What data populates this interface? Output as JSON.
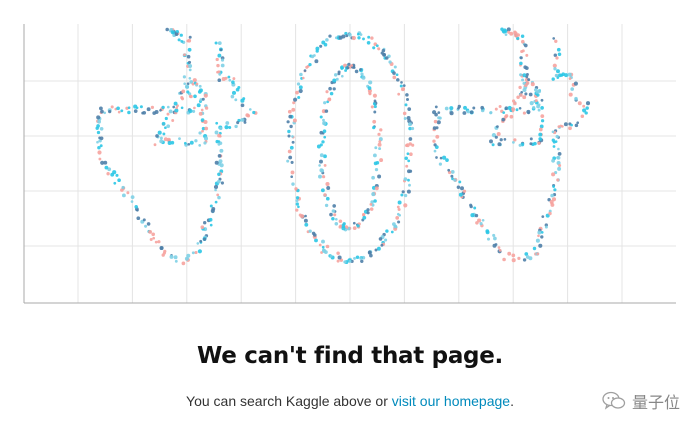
{
  "chart_data": {
    "type": "scatter",
    "title": "",
    "xlabel": "",
    "ylabel": "",
    "xlim": [
      0,
      60
    ],
    "ylim": [
      0,
      26
    ],
    "grid": true,
    "series_colors": [
      "#2bc6e6",
      "#f6a39e",
      "#4f7fa8",
      "#7ed0e6"
    ],
    "shape": "404",
    "glyphs": [
      {
        "char": "4",
        "outline": [
          [
            18,
            1.5
          ],
          [
            18,
            5
          ],
          [
            19.5,
            5
          ],
          [
            19.5,
            6.5
          ],
          [
            21,
            8
          ],
          [
            19.5,
            9.5
          ],
          [
            18,
            9.5
          ],
          [
            18,
            15
          ],
          [
            16,
            21.5
          ],
          [
            14.5,
            22
          ],
          [
            13,
            21.5
          ],
          [
            7,
            12
          ],
          [
            7,
            8
          ],
          [
            16,
            8
          ],
          [
            16,
            6.5
          ],
          [
            15,
            6.5
          ],
          [
            15,
            1.5
          ],
          [
            13,
            0.5
          ],
          [
            15,
            1.5
          ]
        ]
      },
      {
        "char": "0",
        "ellipse": {
          "cx": 30,
          "cy": 11.5,
          "rx": 5.5,
          "ry": 10.5,
          "inner_rx": 2.6,
          "inner_ry": 7.5
        }
      },
      {
        "char": "4",
        "outline": [
          [
            49,
            1.5
          ],
          [
            49,
            5
          ],
          [
            50.5,
            5
          ],
          [
            50.5,
            6.5
          ],
          [
            52,
            8
          ],
          [
            50.5,
            9.5
          ],
          [
            49,
            9.5
          ],
          [
            49,
            15
          ],
          [
            47,
            21.5
          ],
          [
            45.5,
            22
          ],
          [
            44,
            21.5
          ],
          [
            38,
            12
          ],
          [
            38,
            8
          ],
          [
            47,
            8
          ],
          [
            47,
            6.5
          ],
          [
            46,
            6.5
          ],
          [
            46,
            1.5
          ],
          [
            44,
            0.5
          ],
          [
            46,
            1.5
          ]
        ]
      }
    ]
  },
  "headline": "We can't find that page.",
  "subline": {
    "prefix": "You can search Kaggle above or ",
    "link_text": "visit our homepage",
    "suffix": "."
  },
  "watermark": {
    "text": "量子位",
    "icon": "wechat-icon"
  }
}
